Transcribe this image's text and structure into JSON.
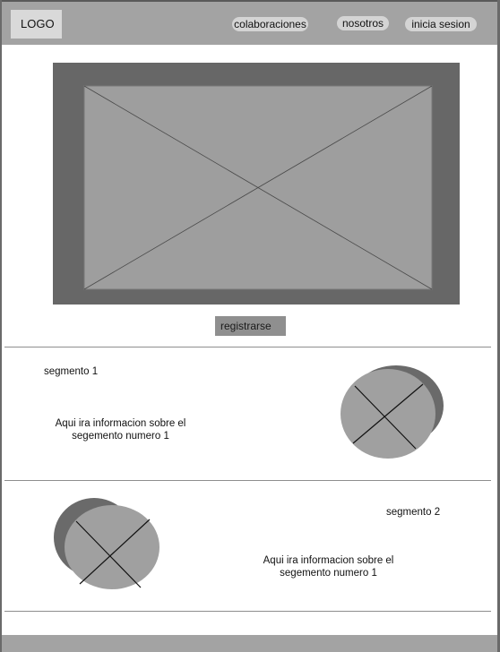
{
  "header": {
    "logo": "LOGO",
    "nav": [
      {
        "label": "colaboraciones"
      },
      {
        "label": "nosotros"
      },
      {
        "label": "inicia sesion"
      }
    ]
  },
  "hero": {
    "register_label": "registrarse"
  },
  "segments": [
    {
      "title": "segmento 1",
      "text_line1": "Aqui ira informacion sobre el",
      "text_line2": "segemento numero 1"
    },
    {
      "title": "segmento 2",
      "text_line1": "Aqui ira informacion sobre el",
      "text_line2": "segemento numero 1"
    }
  ],
  "colors": {
    "header_bg": "#a3a3a3",
    "hero_frame": "#676767",
    "hero_image": "#9e9e9e",
    "circle_fill": "#a0a0a0",
    "circle_shadow": "#6a6a6a"
  }
}
